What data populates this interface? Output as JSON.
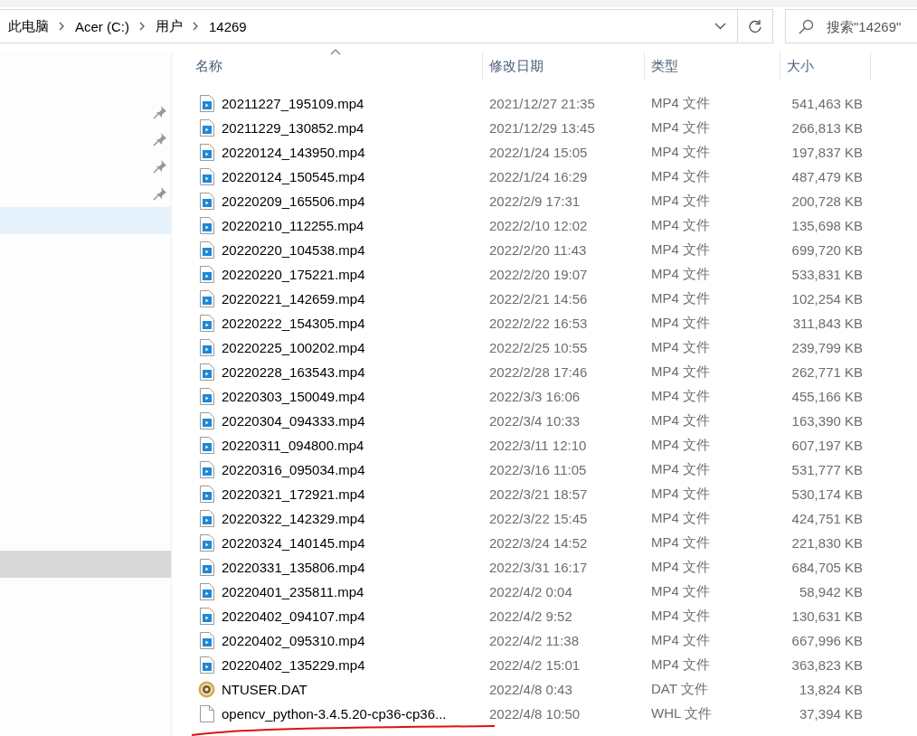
{
  "breadcrumb": [
    "此电脑",
    "Acer (C:)",
    "用户",
    "14269"
  ],
  "search": {
    "placeholder": "搜索\"14269\""
  },
  "sidebar": {
    "items": [
      {
        "pinned": true,
        "hovered": false,
        "selected": false
      },
      {
        "pinned": true,
        "hovered": false,
        "selected": false
      },
      {
        "pinned": true,
        "hovered": false,
        "selected": false
      },
      {
        "pinned": true,
        "hovered": false,
        "selected": false
      },
      {
        "pinned": false,
        "hovered": true,
        "selected": false
      },
      {
        "pinned": false,
        "hovered": false,
        "selected": true
      }
    ]
  },
  "columns": [
    {
      "label": "名称",
      "sorted": true
    },
    {
      "label": "修改日期",
      "sorted": false
    },
    {
      "label": "类型",
      "sorted": false
    },
    {
      "label": "大小",
      "sorted": false
    }
  ],
  "files": [
    {
      "kind": "video",
      "name": "20211227_195109.mp4",
      "date": "2021/12/27 21:35",
      "type": "MP4 文件",
      "size": "541,463 KB"
    },
    {
      "kind": "video",
      "name": "20211229_130852.mp4",
      "date": "2021/12/29 13:45",
      "type": "MP4 文件",
      "size": "266,813 KB"
    },
    {
      "kind": "video",
      "name": "20220124_143950.mp4",
      "date": "2022/1/24 15:05",
      "type": "MP4 文件",
      "size": "197,837 KB"
    },
    {
      "kind": "video",
      "name": "20220124_150545.mp4",
      "date": "2022/1/24 16:29",
      "type": "MP4 文件",
      "size": "487,479 KB"
    },
    {
      "kind": "video",
      "name": "20220209_165506.mp4",
      "date": "2022/2/9 17:31",
      "type": "MP4 文件",
      "size": "200,728 KB"
    },
    {
      "kind": "video",
      "name": "20220210_112255.mp4",
      "date": "2022/2/10 12:02",
      "type": "MP4 文件",
      "size": "135,698 KB"
    },
    {
      "kind": "video",
      "name": "20220220_104538.mp4",
      "date": "2022/2/20 11:43",
      "type": "MP4 文件",
      "size": "699,720 KB"
    },
    {
      "kind": "video",
      "name": "20220220_175221.mp4",
      "date": "2022/2/20 19:07",
      "type": "MP4 文件",
      "size": "533,831 KB"
    },
    {
      "kind": "video",
      "name": "20220221_142659.mp4",
      "date": "2022/2/21 14:56",
      "type": "MP4 文件",
      "size": "102,254 KB"
    },
    {
      "kind": "video",
      "name": "20220222_154305.mp4",
      "date": "2022/2/22 16:53",
      "type": "MP4 文件",
      "size": "311,843 KB"
    },
    {
      "kind": "video",
      "name": "20220225_100202.mp4",
      "date": "2022/2/25 10:55",
      "type": "MP4 文件",
      "size": "239,799 KB"
    },
    {
      "kind": "video",
      "name": "20220228_163543.mp4",
      "date": "2022/2/28 17:46",
      "type": "MP4 文件",
      "size": "262,771 KB"
    },
    {
      "kind": "video",
      "name": "20220303_150049.mp4",
      "date": "2022/3/3 16:06",
      "type": "MP4 文件",
      "size": "455,166 KB"
    },
    {
      "kind": "video",
      "name": "20220304_094333.mp4",
      "date": "2022/3/4 10:33",
      "type": "MP4 文件",
      "size": "163,390 KB"
    },
    {
      "kind": "video",
      "name": "20220311_094800.mp4",
      "date": "2022/3/11 12:10",
      "type": "MP4 文件",
      "size": "607,197 KB"
    },
    {
      "kind": "video",
      "name": "20220316_095034.mp4",
      "date": "2022/3/16 11:05",
      "type": "MP4 文件",
      "size": "531,777 KB"
    },
    {
      "kind": "video",
      "name": "20220321_172921.mp4",
      "date": "2022/3/21 18:57",
      "type": "MP4 文件",
      "size": "530,174 KB"
    },
    {
      "kind": "video",
      "name": "20220322_142329.mp4",
      "date": "2022/3/22 15:45",
      "type": "MP4 文件",
      "size": "424,751 KB"
    },
    {
      "kind": "video",
      "name": "20220324_140145.mp4",
      "date": "2022/3/24 14:52",
      "type": "MP4 文件",
      "size": "221,830 KB"
    },
    {
      "kind": "video",
      "name": "20220331_135806.mp4",
      "date": "2022/3/31 16:17",
      "type": "MP4 文件",
      "size": "684,705 KB"
    },
    {
      "kind": "video",
      "name": "20220401_235811.mp4",
      "date": "2022/4/2 0:04",
      "type": "MP4 文件",
      "size": "58,942 KB"
    },
    {
      "kind": "video",
      "name": "20220402_094107.mp4",
      "date": "2022/4/2 9:52",
      "type": "MP4 文件",
      "size": "130,631 KB"
    },
    {
      "kind": "video",
      "name": "20220402_095310.mp4",
      "date": "2022/4/2 11:38",
      "type": "MP4 文件",
      "size": "667,996 KB"
    },
    {
      "kind": "video",
      "name": "20220402_135229.mp4",
      "date": "2022/4/2 15:01",
      "type": "MP4 文件",
      "size": "363,823 KB"
    },
    {
      "kind": "system",
      "name": "NTUSER.DAT",
      "date": "2022/4/8 0:43",
      "type": "DAT 文件",
      "size": "13,824 KB"
    },
    {
      "kind": "document",
      "name": "opencv_python-3.4.5.20-cp36-cp36...",
      "date": "2022/4/8 10:50",
      "type": "WHL 文件",
      "size": "37,394 KB",
      "underlined": true
    }
  ]
}
